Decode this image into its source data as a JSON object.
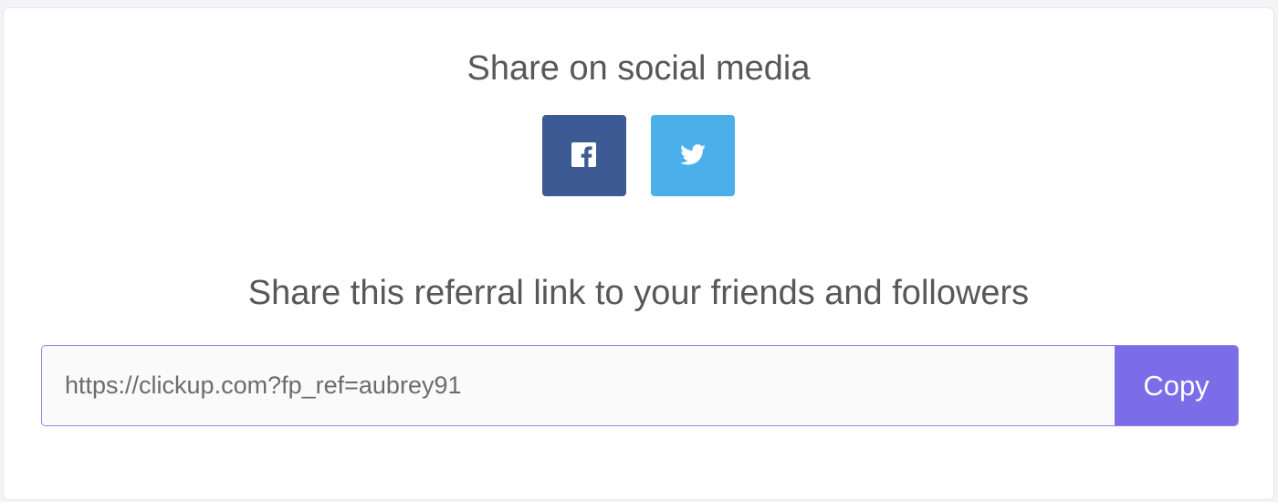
{
  "social": {
    "heading": "Share on social media",
    "buttons": [
      {
        "name": "facebook",
        "icon": "facebook-icon",
        "color": "#3e5a94"
      },
      {
        "name": "twitter",
        "icon": "twitter-icon",
        "color": "#4bb0ea"
      }
    ]
  },
  "referral": {
    "heading": "Share this referral link to your friends and followers",
    "link_value": "https://clickup.com?fp_ref=aubrey91",
    "copy_label": "Copy",
    "accent_color": "#7b6ce8"
  }
}
